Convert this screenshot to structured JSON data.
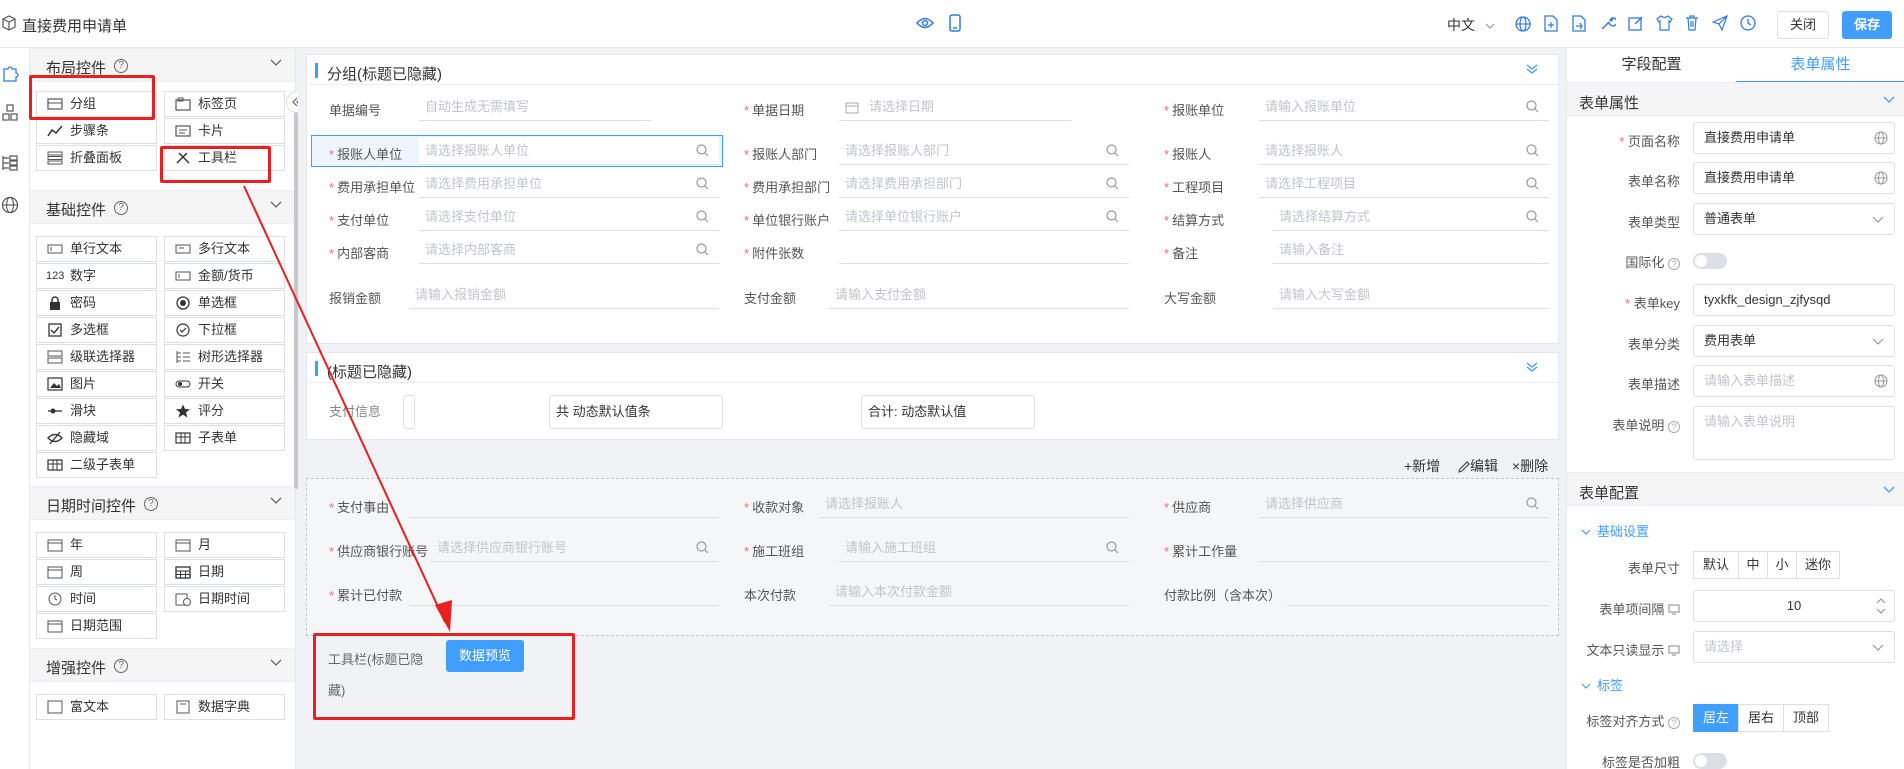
{
  "header": {
    "title": "直接费用申请单",
    "language": "中文",
    "close_label": "关闭",
    "save_label": "保存"
  },
  "left_panel": {
    "sections": [
      {
        "title": "布局控件",
        "items": [
          "分组",
          "标签页",
          "步骤条",
          "卡片",
          "折叠面板",
          "工具栏"
        ]
      },
      {
        "title": "基础控件",
        "items": [
          "单行文本",
          "多行文本",
          "数字",
          "金额/货币",
          "密码",
          "单选框",
          "多选框",
          "下拉框",
          "级联选择器",
          "树形选择器",
          "图片",
          "开关",
          "滑块",
          "评分",
          "隐藏域",
          "子表单",
          "二级子表单"
        ]
      },
      {
        "title": "日期时间控件",
        "items": [
          "年",
          "月",
          "周",
          "日期",
          "时间",
          "日期时间",
          "日期范围"
        ]
      },
      {
        "title": "增强控件",
        "items": [
          "富文本",
          "数据字典"
        ]
      }
    ],
    "num_icon_text": "123"
  },
  "group1": {
    "title": "分组(标题已隐藏)",
    "fields": [
      {
        "label": "单据编号",
        "placeholder": "自动生成无需填写",
        "required": false
      },
      {
        "label": "单据日期",
        "placeholder": "请选择日期",
        "required": true
      },
      {
        "label": "报账单位",
        "placeholder": "请输入报账单位",
        "required": true
      },
      {
        "label": "报账人单位",
        "placeholder": "请选择报账人单位",
        "required": true
      },
      {
        "label": "报账人部门",
        "placeholder": "请选择报账人部门",
        "required": true
      },
      {
        "label": "报账人",
        "placeholder": "请选择报账人",
        "required": true
      },
      {
        "label": "费用承担单位",
        "placeholder": "请选择费用承担单位",
        "required": true
      },
      {
        "label": "费用承担部门",
        "placeholder": "请选择费用承担部门",
        "required": true
      },
      {
        "label": "工程项目",
        "placeholder": "请选择工程项目",
        "required": true
      },
      {
        "label": "支付单位",
        "placeholder": "请选择支付单位",
        "required": true
      },
      {
        "label": "单位银行账户",
        "placeholder": "请选择单位银行账户",
        "required": true
      },
      {
        "label": "结算方式",
        "placeholder": "请选择结算方式",
        "required": true
      },
      {
        "label": "内部客商",
        "placeholder": "请选择内部客商",
        "required": true
      },
      {
        "label": "附件张数",
        "placeholder": "",
        "required": true
      },
      {
        "label": "备注",
        "placeholder": "请输入备注",
        "required": true
      },
      {
        "label": "报销金额",
        "placeholder": "请输入报销金额",
        "required": false
      },
      {
        "label": "支付金额",
        "placeholder": "请输入支付金额",
        "required": false
      },
      {
        "label": "大写金额",
        "placeholder": "请输入大写金额",
        "required": false
      }
    ]
  },
  "group2": {
    "title": "(标题已隐藏)",
    "pay_label": "支付信息",
    "count_text": "共 动态默认值条",
    "total_text": "合计: 动态默认值"
  },
  "subform": {
    "add_label": "+新增",
    "edit_label": "编辑",
    "delete_label": "×删除",
    "fields": [
      {
        "label": "支付事由",
        "placeholder": "",
        "required": true
      },
      {
        "label": "收款对象",
        "placeholder": "请选择报账人",
        "required": true
      },
      {
        "label": "供应商",
        "placeholder": "请选择供应商",
        "required": true
      },
      {
        "label": "供应商银行账号",
        "placeholder": "请选择供应商银行账号",
        "required": true
      },
      {
        "label": "施工班组",
        "placeholder": "请输入施工班组",
        "required": true
      },
      {
        "label": "累计工作量",
        "placeholder": "",
        "required": true
      },
      {
        "label": "累计已付款",
        "placeholder": "",
        "required": true
      },
      {
        "label": "本次付款",
        "placeholder": "请输入本次付款金额",
        "required": false
      },
      {
        "label": "付款比例（含本次）",
        "placeholder": "",
        "required": false
      }
    ]
  },
  "toolbar_widget": {
    "label_line1": "工具栏(标题已隐",
    "label_line2": "藏)",
    "preview_button": "数据预览"
  },
  "right_panel": {
    "tabs": [
      "字段配置",
      "表单属性"
    ],
    "form_props_title": "表单属性",
    "page_name_label": "页面名称",
    "page_name_value": "直接费用申请单",
    "form_name_label": "表单名称",
    "form_name_value": "直接费用申请单",
    "form_type_label": "表单类型",
    "form_type_value": "普通表单",
    "i18n_label": "国际化",
    "form_key_label": "表单key",
    "form_key_value": "tyxkfk_design_zjfysqd",
    "form_category_label": "表单分类",
    "form_category_value": "费用表单",
    "form_desc_label": "表单描述",
    "form_desc_placeholder": "请输入表单描述",
    "form_note_label": "表单说明",
    "form_note_placeholder": "请输入表单说明",
    "form_config_title": "表单配置",
    "basic_settings": "基础设置",
    "form_size_label": "表单尺寸",
    "sizes": [
      "默认",
      "中",
      "小",
      "迷你"
    ],
    "item_gap_label": "表单项间隔",
    "item_gap_value": "10",
    "readonly_label": "文本只读显示",
    "readonly_placeholder": "请选择",
    "label_section": "标签",
    "label_align_label": "标签对齐方式",
    "aligns": [
      "居左",
      "居右",
      "顶部"
    ],
    "label_bold_label": "标签是否加粗"
  },
  "colors": {
    "accent": "#409eff",
    "required": "#f56c6c",
    "highlight_box": "#e8201f"
  }
}
